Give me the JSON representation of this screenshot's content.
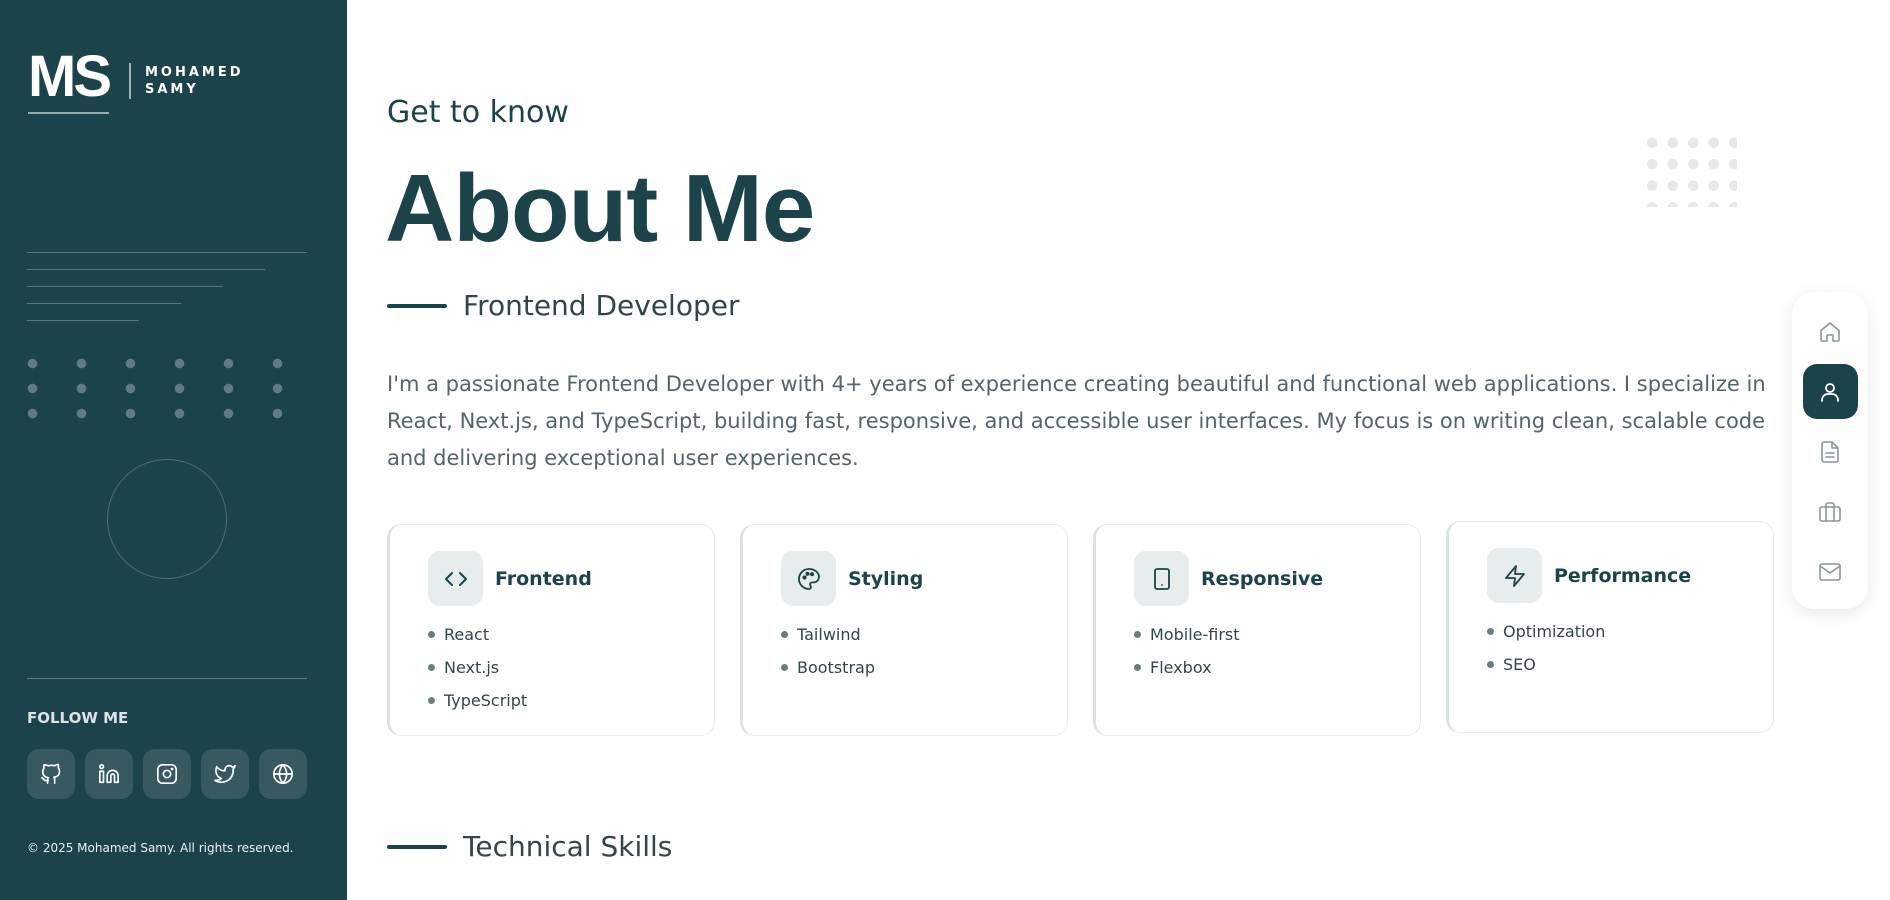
{
  "brand": {
    "mark": "MS",
    "name_line1": "MOHAMED",
    "name_line2": "SAMY"
  },
  "sidebar": {
    "follow_label": "FOLLOW ME",
    "socials": [
      {
        "name": "GitHub",
        "icon": "github-icon"
      },
      {
        "name": "LinkedIn",
        "icon": "linkedin-icon"
      },
      {
        "name": "Instagram",
        "icon": "instagram-icon"
      },
      {
        "name": "Twitter",
        "icon": "twitter-icon"
      },
      {
        "name": "Website",
        "icon": "globe-icon"
      }
    ],
    "copyright": "© 2025 Mohamed Samy. All rights reserved."
  },
  "about": {
    "eyebrow": "Get to know",
    "title": "About Me",
    "role": "Frontend Developer",
    "intro": "I'm a passionate Frontend Developer with 4+ years of experience creating beautiful and functional web applications. I specialize in React, Next.js, and TypeScript, building fast, responsive, and accessible user interfaces. My focus is on writing clean, scalable code and delivering exceptional user experiences.",
    "cards": [
      {
        "title": "Frontend",
        "icon": "code-icon",
        "items": [
          "React",
          "Next.js",
          "TypeScript"
        ]
      },
      {
        "title": "Styling",
        "icon": "palette-icon",
        "items": [
          "Tailwind",
          "Bootstrap"
        ]
      },
      {
        "title": "Responsive",
        "icon": "smartphone-icon",
        "items": [
          "Mobile-first",
          "Flexbox"
        ]
      },
      {
        "title": "Performance",
        "icon": "lightning-icon",
        "items": [
          "Optimization",
          "SEO"
        ]
      }
    ],
    "next_section": "Technical Skills"
  },
  "nav": {
    "items": [
      {
        "icon": "home-icon",
        "active": false
      },
      {
        "icon": "user-icon",
        "active": true
      },
      {
        "icon": "document-icon",
        "active": false
      },
      {
        "icon": "briefcase-icon",
        "active": false
      },
      {
        "icon": "mail-icon",
        "active": false
      }
    ]
  },
  "colors": {
    "primary": "#1d434a",
    "text": "#34454a",
    "muted": "#55646b",
    "card_icon_bg": "#e7eced"
  }
}
